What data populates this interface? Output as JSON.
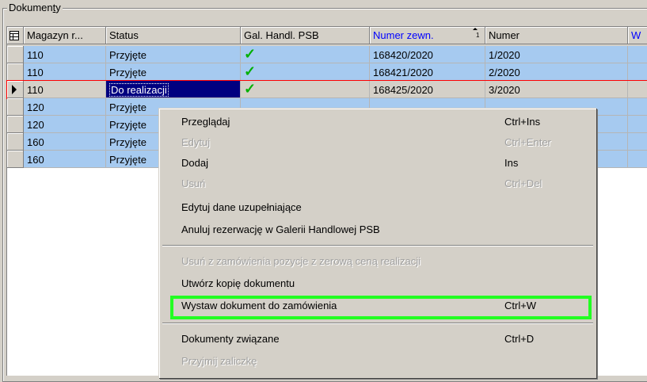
{
  "group_title_prefix": "Dokumen",
  "group_title_u": "t",
  "group_title_suffix": "y",
  "columns": [
    {
      "label": "Magazyn r..."
    },
    {
      "label": "Status"
    },
    {
      "label": "Gal. Handl. PSB"
    },
    {
      "label": "Numer zewn."
    },
    {
      "label": "Numer"
    },
    {
      "label": "W"
    }
  ],
  "sort_icon": "sort-ascending-icon",
  "rows": [
    {
      "magazyn": "110",
      "status": "Przyjęte",
      "gal": "✓",
      "numer_zewn": "168420/2020",
      "numer": "1/2020"
    },
    {
      "magazyn": "110",
      "status": "Przyjęte",
      "gal": "✓",
      "numer_zewn": "168421/2020",
      "numer": "2/2020"
    },
    {
      "magazyn": "110",
      "status": "Do realizacji",
      "gal": "✓",
      "numer_zewn": "168425/2020",
      "numer": "3/2020"
    },
    {
      "magazyn": "120",
      "status": "Przyjęte",
      "gal": "",
      "numer_zewn": "",
      "numer": ""
    },
    {
      "magazyn": "120",
      "status": "Przyjęte",
      "gal": "",
      "numer_zewn": "",
      "numer": ""
    },
    {
      "magazyn": "160",
      "status": "Przyjęte",
      "gal": "",
      "numer_zewn": "",
      "numer": ""
    },
    {
      "magazyn": "160",
      "status": "Przyjęte",
      "gal": "",
      "numer_zewn": "",
      "numer": ""
    }
  ],
  "menu": [
    {
      "label": "Przeglądaj",
      "shortcut": "Ctrl+Ins",
      "enabled": true
    },
    {
      "label": "Edytuj",
      "shortcut": "Ctrl+Enter",
      "enabled": false
    },
    {
      "label": "Dodaj",
      "shortcut": "Ins",
      "enabled": true
    },
    {
      "label": "Usuń",
      "shortcut": "Ctrl+Del",
      "enabled": false
    },
    {
      "label": "Edytuj dane uzupełniające",
      "shortcut": "",
      "enabled": true
    },
    {
      "label": "Anuluj rezerwację w Galerii Handlowej PSB",
      "shortcut": "",
      "enabled": true
    },
    {
      "label": "Usuń z zamówienia pozycje z zerową ceną realizacji",
      "shortcut": "",
      "enabled": false
    },
    {
      "label": "Utwórz kopię dokumentu",
      "shortcut": "",
      "enabled": true
    },
    {
      "label": "Wystaw dokument do zamówienia",
      "shortcut": "Ctrl+W",
      "enabled": true
    },
    {
      "label": "Dokumenty związane",
      "shortcut": "Ctrl+D",
      "enabled": true
    },
    {
      "label": "Przyjmij zaliczkę",
      "shortcut": "",
      "enabled": false
    }
  ],
  "colors": {
    "row_blue": "#a6caf0",
    "selection": "#000080",
    "highlight_box": "#22ff22",
    "check": "#00b000",
    "current_row_border": "#ff0000"
  }
}
